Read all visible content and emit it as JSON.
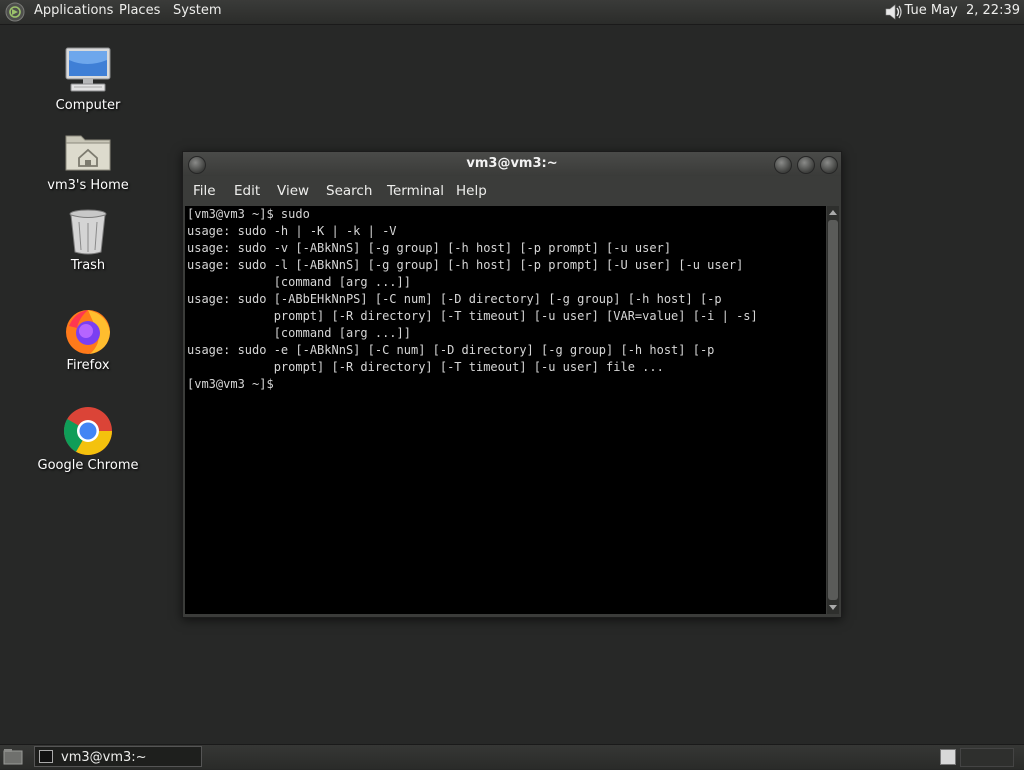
{
  "top_panel": {
    "menus": [
      "Applications",
      "Places",
      "System"
    ],
    "clock": "Tue May  2, 22:39",
    "menu_icon": "gnome-foot-icon",
    "volume_icon": "speaker-icon"
  },
  "desktop_icons": [
    {
      "label": "Computer",
      "icon": "computer-icon"
    },
    {
      "label": "vm3's Home",
      "icon": "home-folder-icon"
    },
    {
      "label": "Trash",
      "icon": "trash-icon"
    },
    {
      "label": "Firefox",
      "icon": "firefox-icon"
    },
    {
      "label": "Google Chrome",
      "icon": "chrome-icon"
    }
  ],
  "window": {
    "title": "vm3@vm3:~",
    "menu": [
      "File",
      "Edit",
      "View",
      "Search",
      "Terminal",
      "Help"
    ],
    "terminal_lines": [
      "[vm3@vm3 ~]$ sudo",
      "usage: sudo -h | -K | -k | -V",
      "usage: sudo -v [-ABkNnS] [-g group] [-h host] [-p prompt] [-u user]",
      "usage: sudo -l [-ABkNnS] [-g group] [-h host] [-p prompt] [-U user] [-u user]",
      "            [command [arg ...]]",
      "usage: sudo [-ABbEHkNnPS] [-C num] [-D directory] [-g group] [-h host] [-p",
      "            prompt] [-R directory] [-T timeout] [-u user] [VAR=value] [-i | -s]",
      "            [command [arg ...]]",
      "usage: sudo -e [-ABkNnS] [-C num] [-D directory] [-g group] [-h host] [-p",
      "            prompt] [-R directory] [-T timeout] [-u user] file ...",
      "[vm3@vm3 ~]$"
    ]
  },
  "bottom_panel": {
    "task_label": "vm3@vm3:~"
  },
  "colors": {
    "desktop_bg": "#272827",
    "terminal_bg": "#000000",
    "terminal_fg": "#d6d6d6"
  }
}
